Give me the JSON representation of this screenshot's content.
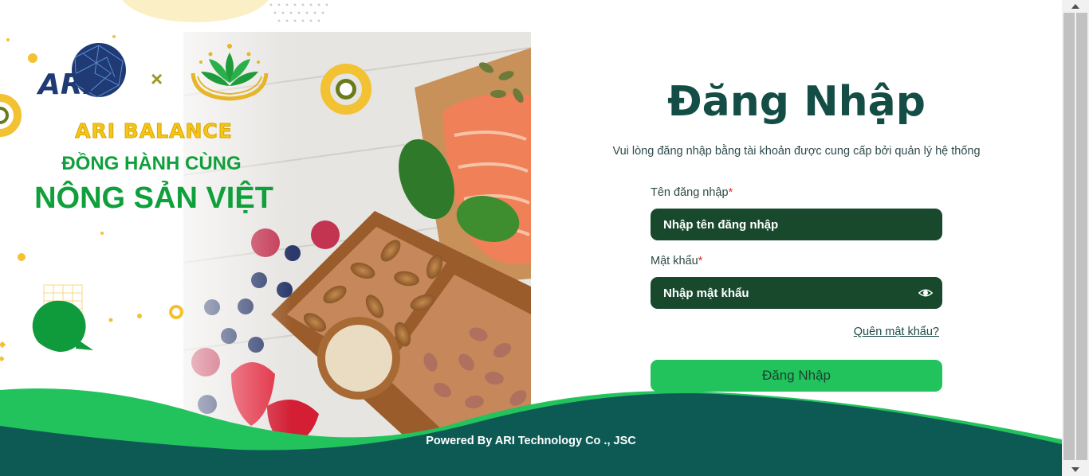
{
  "hero": {
    "brand_logo_text": "ARI",
    "x_mark": "×",
    "tagline_1": "ARI BALANCE",
    "tagline_2": "ĐỒNG HÀNH CÙNG",
    "tagline_3": "NÔNG SẢN VIỆT"
  },
  "login": {
    "title": "Đăng Nhập",
    "subtitle": "Vui lòng đăng nhập bằng tài khoản được cung cấp bởi quản lý hệ thống",
    "username_label": "Tên đăng nhập",
    "username_placeholder": "Nhập tên đăng nhập",
    "password_label": "Mật khẩu",
    "password_placeholder": "Nhập mật khẩu",
    "required_mark": "*",
    "forgot_link": "Quên mật khẩu?",
    "submit_label": "Đăng Nhập"
  },
  "footer": {
    "powered_by": "Powered By ARI Technology Co ., JSC"
  },
  "colors": {
    "title": "#134d45",
    "input_bg": "#19492d",
    "button_bg": "#22c35c",
    "footer_dark": "#0d5a55",
    "footer_green": "#22c35c",
    "brand_green": "#10a03b",
    "brand_yellow": "#f5c519"
  },
  "icons": [
    "eye-icon",
    "scroll-up-icon",
    "scroll-down-icon"
  ]
}
